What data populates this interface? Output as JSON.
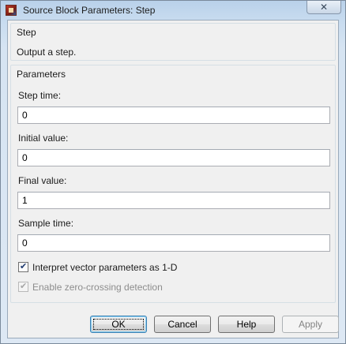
{
  "window": {
    "title": "Source Block Parameters: Step",
    "close_glyph": "✕",
    "app_icon": "simulink-block-icon"
  },
  "step_group": {
    "title": "Step",
    "description": "Output a step."
  },
  "params_group": {
    "title": "Parameters",
    "fields": [
      {
        "label": "Step time:",
        "value": "0"
      },
      {
        "label": "Initial value:",
        "value": "0"
      },
      {
        "label": "Final value:",
        "value": "1"
      },
      {
        "label": "Sample time:",
        "value": "0"
      }
    ],
    "checkboxes": [
      {
        "label": "Interpret vector parameters as 1-D",
        "checked": true,
        "enabled": true
      },
      {
        "label": "Enable zero-crossing detection",
        "checked": true,
        "enabled": false
      }
    ]
  },
  "buttons": {
    "ok": "OK",
    "cancel": "Cancel",
    "help": "Help",
    "apply": "Apply"
  },
  "colors": {
    "title_bar": "#b9d1ea",
    "dialog_bg": "#f0f0f0",
    "default_button_border": "#3c7fb1"
  }
}
